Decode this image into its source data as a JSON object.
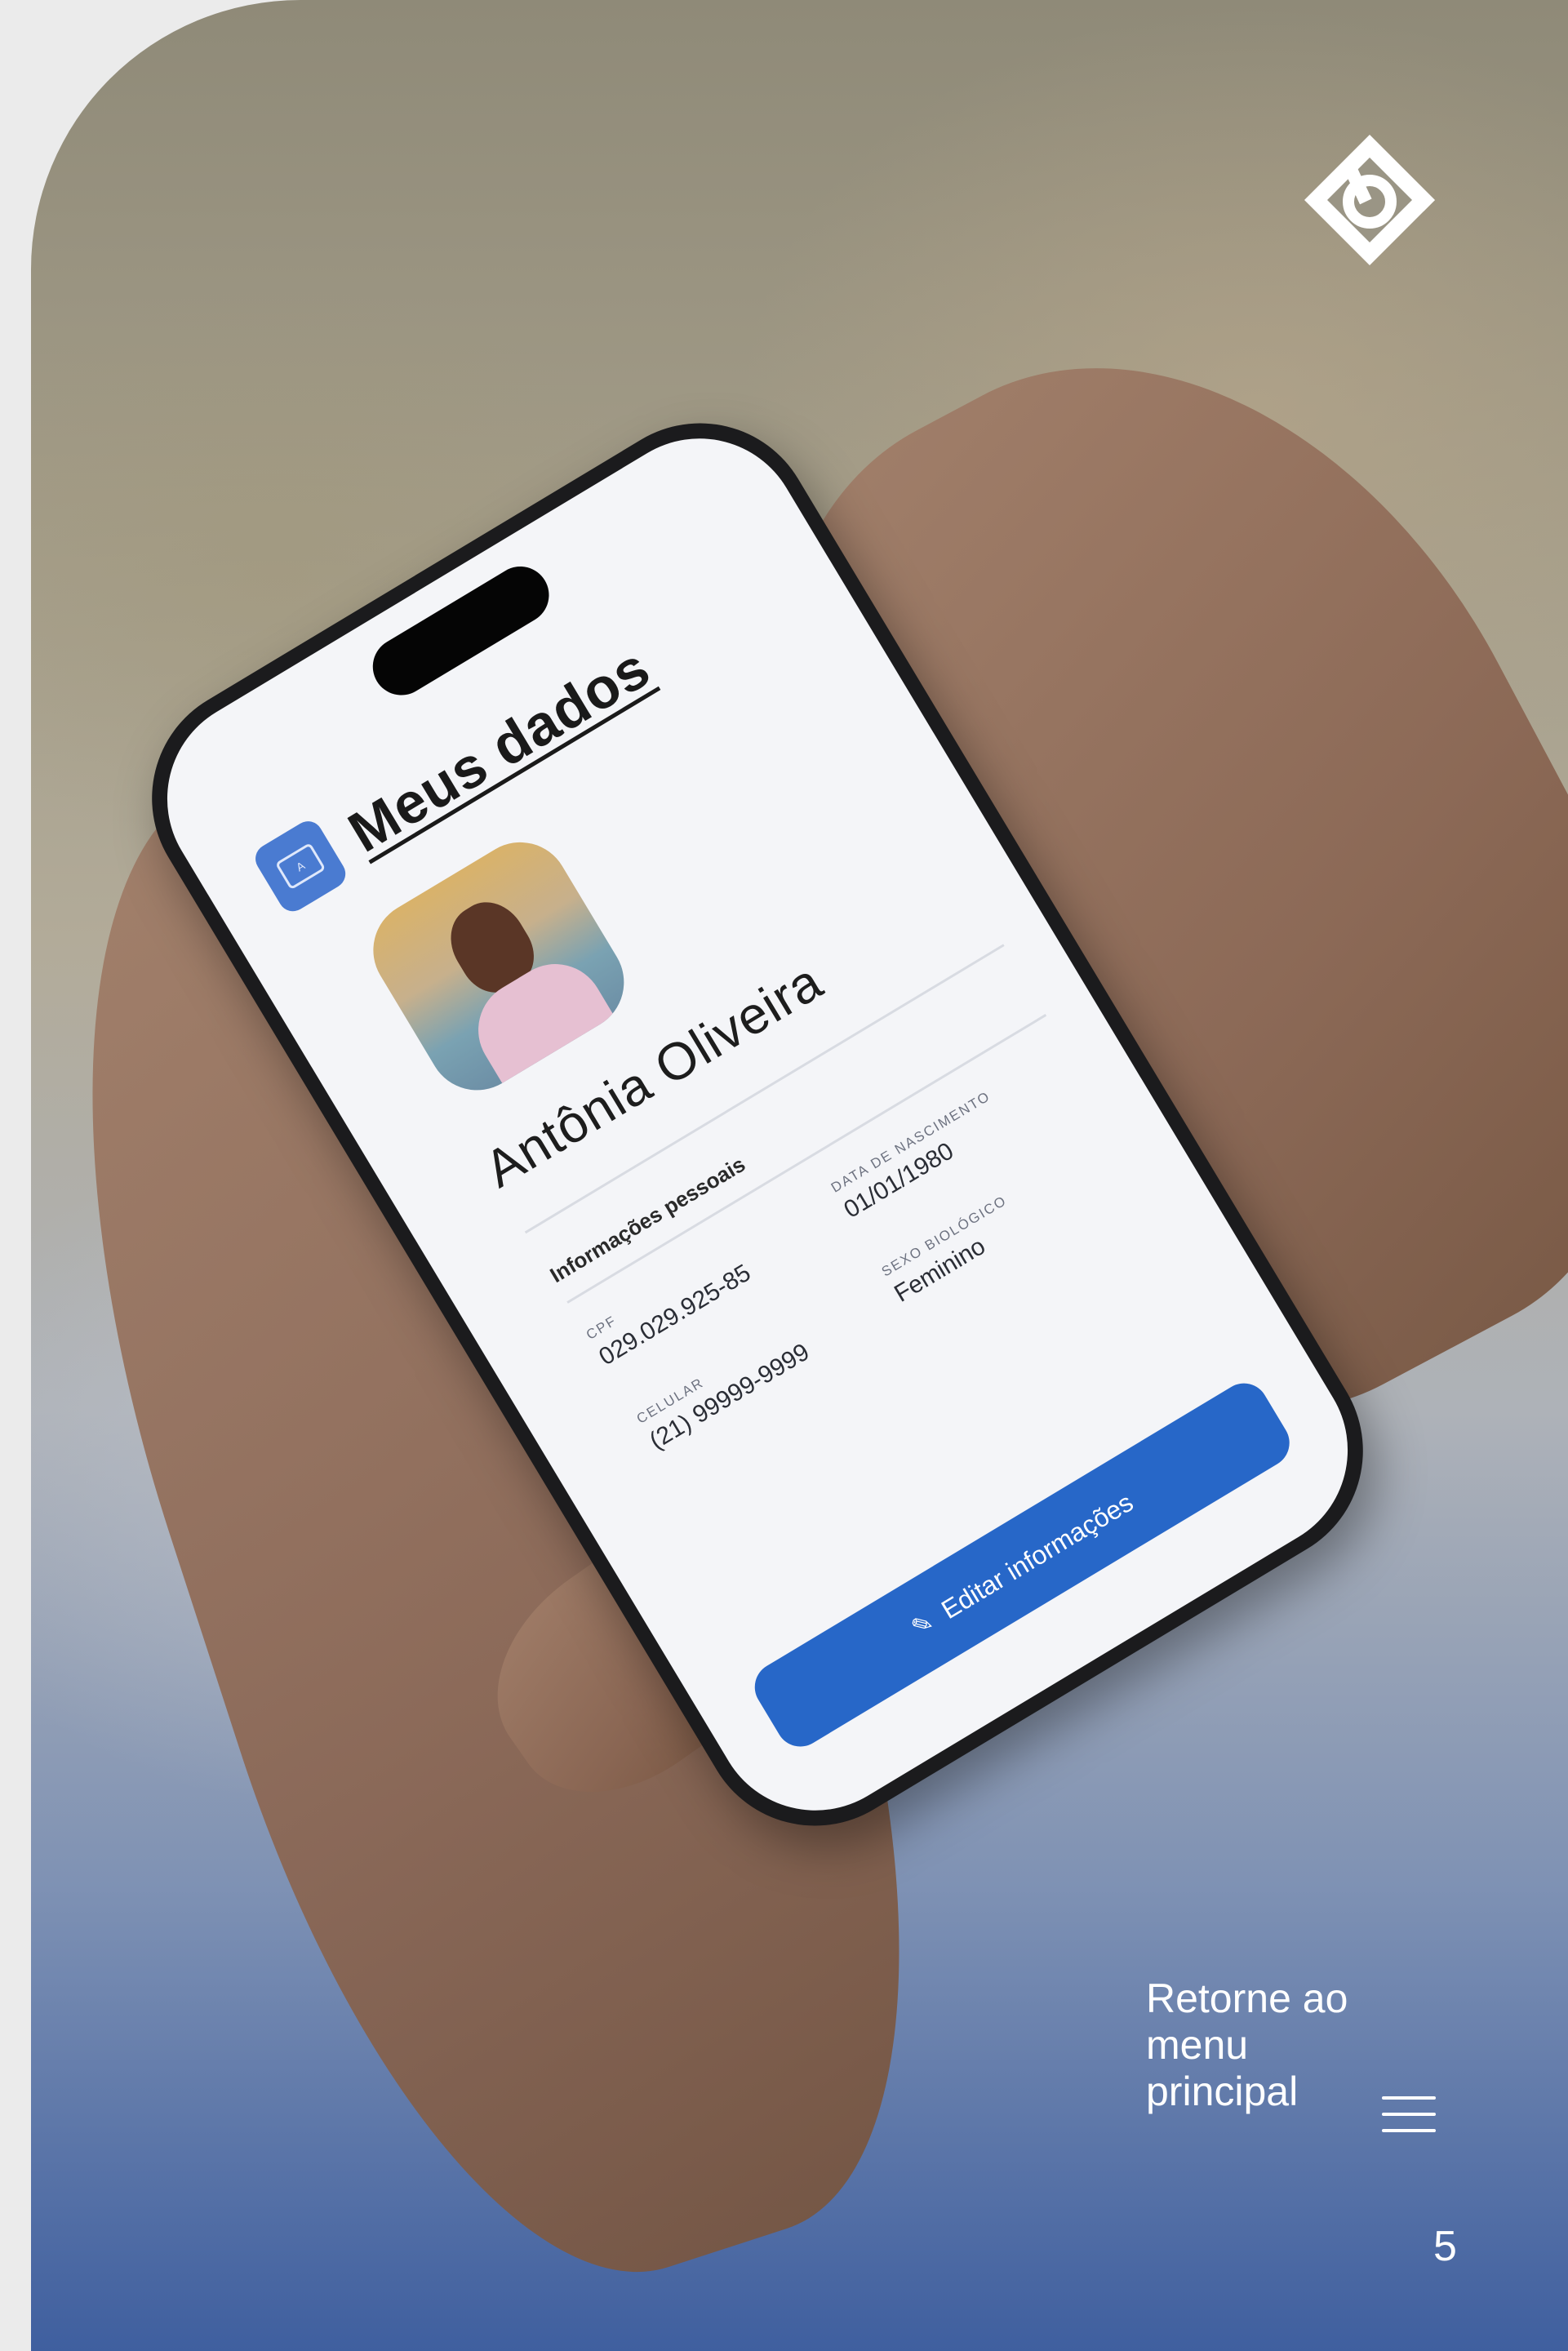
{
  "app": {
    "title": "Meus dados",
    "icon_text": "A",
    "profile": {
      "name": "Antônia Oliveira"
    },
    "section_title": "Informações pessoais",
    "fields": [
      {
        "label": "CPF",
        "value": "029.029.925-85"
      },
      {
        "label": "Data de nascimento",
        "value": "01/01/1980"
      },
      {
        "label": "Celular",
        "value": "(21) 99999-9999"
      },
      {
        "label": "Sexo biológico",
        "value": "Feminino"
      }
    ],
    "edit_button_label": "Editar informações"
  },
  "page": {
    "return_text": "Retorne ao menu principal",
    "page_number": "5",
    "icons": {
      "logo": "brand-logo-icon",
      "menu": "hamburger-menu-icon",
      "edit": "pencil-icon"
    },
    "colors": {
      "accent": "#2767c8",
      "overlay_bottom": "#3f5f9f"
    }
  }
}
